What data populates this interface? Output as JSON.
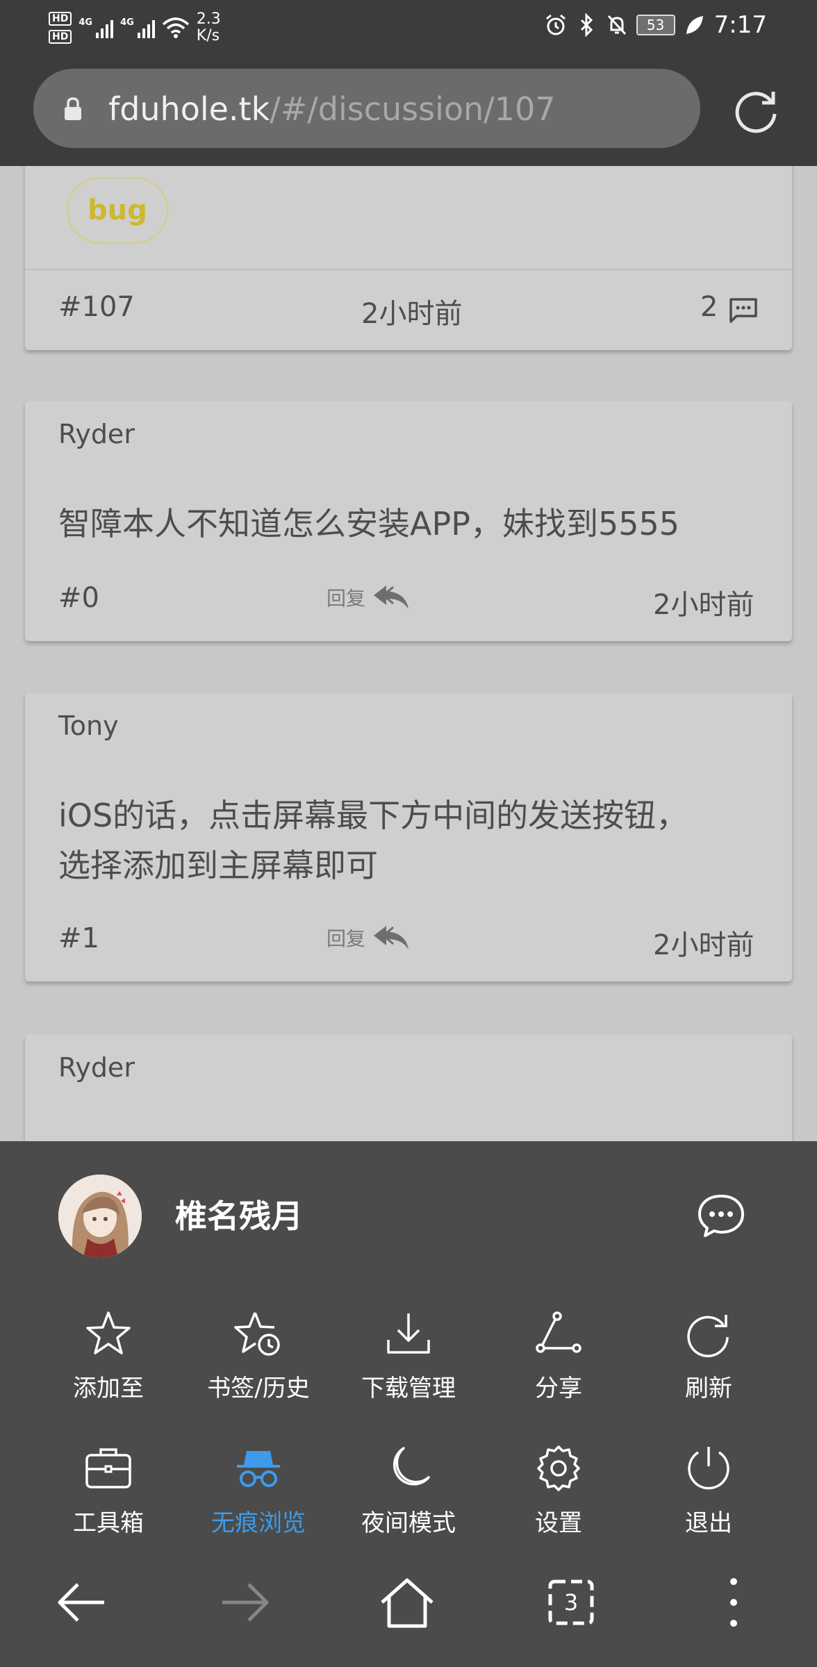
{
  "status_bar": {
    "hd1": "HD",
    "hd2": "HD",
    "net1": "4G",
    "net2": "4G",
    "speed_value": "2.3",
    "speed_unit": "K/s",
    "battery": "53",
    "time": "7:17",
    "icons": [
      "alarm-icon",
      "bluetooth-icon",
      "mute-icon",
      "battery-icon",
      "leaf-icon"
    ]
  },
  "browser": {
    "url_host": "fduhole.tk",
    "url_path": "/#/discussion/107"
  },
  "discussion": {
    "tag": "bug",
    "id": "#107",
    "time": "2小时前",
    "reply_count": "2"
  },
  "posts": [
    {
      "author": "Ryder",
      "lines": [
        "智障本人不知道怎么安装APP，妹找到5555"
      ],
      "floor": "#0",
      "reply_label": "回复",
      "time": "2小时前"
    },
    {
      "author": "Tony",
      "lines": [
        "iOS的话，点击屏幕最下方中间的发送按钮，",
        "选择添加到主屏幕即可"
      ],
      "floor": "#1",
      "reply_label": "回复",
      "time": "2小时前"
    },
    {
      "author": "Ryder"
    }
  ],
  "menu": {
    "username": "椎名残月",
    "items": [
      {
        "label": "添加至",
        "icon": "star-icon"
      },
      {
        "label": "书签/历史",
        "icon": "bookmark-history-icon"
      },
      {
        "label": "下载管理",
        "icon": "download-icon"
      },
      {
        "label": "分享",
        "icon": "share-icon"
      },
      {
        "label": "刷新",
        "icon": "refresh-icon"
      },
      {
        "label": "工具箱",
        "icon": "toolbox-icon"
      },
      {
        "label": "无痕浏览",
        "icon": "incognito-icon",
        "active": true
      },
      {
        "label": "夜间模式",
        "icon": "moon-icon"
      },
      {
        "label": "设置",
        "icon": "settings-icon"
      },
      {
        "label": "退出",
        "icon": "power-icon"
      }
    ]
  },
  "nav": {
    "tab_count": "3"
  },
  "colors": {
    "bars": "#3c3c3c",
    "page_background": "#c8c8c8",
    "card": "#cfcfcf",
    "tag": "#cdb82e",
    "sheet": "#4b4b4b",
    "active": "#3d9be9"
  }
}
